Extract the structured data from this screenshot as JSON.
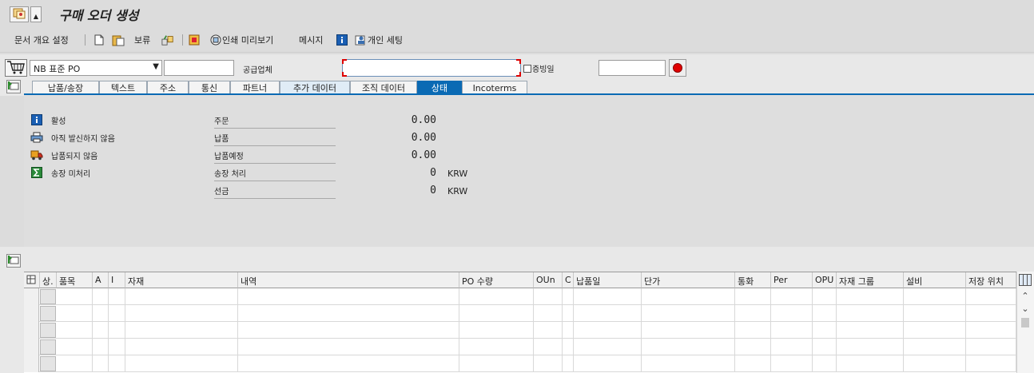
{
  "title": "구매 오더 생성",
  "toolbar": {
    "doc_overview": "문서 개요 설정",
    "hold": "보류",
    "print_preview": "인쇄 미리보기",
    "messages": "메시지",
    "personal_settings": "개인 세팅"
  },
  "header": {
    "doc_type": "NB 표준 PO",
    "doc_number": "",
    "vendor_label": "공급업체",
    "vendor_value": "",
    "doc_date_label": "증빙일",
    "doc_date_value": ""
  },
  "tabs": [
    {
      "label": "납품/송장",
      "state": "normal"
    },
    {
      "label": "텍스트",
      "state": "normal"
    },
    {
      "label": "주소",
      "state": "normal"
    },
    {
      "label": "통신",
      "state": "normal"
    },
    {
      "label": "파트너",
      "state": "normal"
    },
    {
      "label": "추가 데이터",
      "state": "light"
    },
    {
      "label": "조직 데이터",
      "state": "normal"
    },
    {
      "label": "상태",
      "state": "active"
    },
    {
      "label": "Incoterms",
      "state": "normal"
    }
  ],
  "status": {
    "items": [
      {
        "icon": "info-icon",
        "label": "활성"
      },
      {
        "icon": "printer-icon",
        "label": "아직 발신하지 않음"
      },
      {
        "icon": "truck-icon",
        "label": "납품되지 않음"
      },
      {
        "icon": "sigma-icon",
        "label": "송장 미처리"
      }
    ],
    "figures": [
      {
        "label": "주문",
        "value": "0.00",
        "currency": ""
      },
      {
        "label": "납품",
        "value": "0.00",
        "currency": ""
      },
      {
        "label": "납품예정",
        "value": "0.00",
        "currency": ""
      },
      {
        "label": "송장 처리",
        "value": "0",
        "currency": "KRW"
      },
      {
        "label": "선금",
        "value": "0",
        "currency": "KRW"
      }
    ]
  },
  "items_grid": {
    "columns": [
      "상.",
      "품목",
      "A",
      "I",
      "자재",
      "내역",
      "PO 수량",
      "OUn",
      "C",
      "납품일",
      "단가",
      "통화",
      "Per",
      "OPU",
      "자재 그룹",
      "설비",
      "저장 위치"
    ],
    "rows": 5
  },
  "colors": {
    "active_tab": "#0a6ab4",
    "required_marker": "#dd0000",
    "record_button": "#e00000"
  }
}
